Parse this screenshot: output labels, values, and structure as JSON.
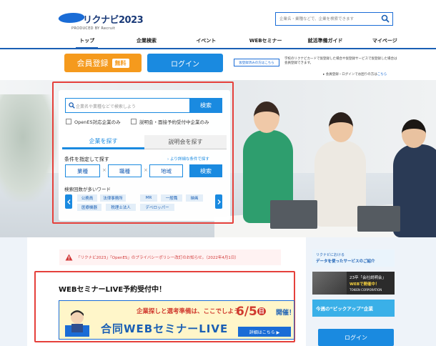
{
  "header": {
    "logo_text": "リクナビ2023",
    "logo_sub": "PRODUCED BY Recruit",
    "search_placeholder": "企業名・業種などで、企業を検索できます",
    "nav": [
      "トップ",
      "企業検索",
      "イベント",
      "WEBセミナー",
      "就活準備ガイド",
      "マイページ"
    ]
  },
  "auth": {
    "register_label": "会員登録",
    "free_badge": "無料",
    "login_label": "ログイン",
    "mynavi_link": "仮登録済みの方はこちら",
    "mynavi_note": "学校のリクナビカードで仮登録した場合や仮登録サービスで仮登録した場合は会員登録できます。",
    "login_note_prefix": "▸ 会員登録・ログインでお困りの方は",
    "login_note_link": "こちら"
  },
  "search_panel": {
    "keyword_placeholder": "企業名や業種などで検索しよう",
    "search_button": "検索",
    "check_openes": "OpenES対応企業のみ",
    "check_briefing": "説明会・面接予約受付中企業のみ",
    "tab_company": "企業を探す",
    "tab_briefing": "説明会を探す",
    "condition_label": "条件を指定して探す",
    "condition_more": "› より詳細な条件で探す",
    "select_industry": "業種",
    "select_job": "職種",
    "select_area": "地域",
    "condition_search": "検索",
    "times": "×",
    "hot_label": "検索回数が多いワード",
    "hot_words": [
      "公務員",
      "法律事務所",
      "MR",
      "一般職",
      "映画",
      "医療機器",
      "税理士法人",
      "デベロッパー"
    ]
  },
  "notice": {
    "text": "「リクナビ2023」「OpenES」のプライバシーポリシー改訂のお知らせ。（2022年4月1日）"
  },
  "web_seminar": {
    "title": "WEBセミナーLIVE予約受付中！",
    "banner_headline": "企業探しと選考準備は、ここでしよう",
    "banner_big": "合同WEBセミナーLIVE",
    "banner_date": "6/5",
    "banner_day": "日",
    "banner_kaisai": "開催！",
    "banner_detail": "詳細はこちら ▶"
  },
  "side_ads": {
    "ad1_line1": "リクナビにおける",
    "ad1_line2": "データを使ったサービスのご紹介",
    "ad2_line1": "23卒「会社説明会」",
    "ad2_line2": "WEBで開催中！",
    "ad2_line3": "TOKIEN CORPORATION",
    "ad3_text": "今週の“ピックアップ”企業",
    "login_label": "ログイン"
  },
  "colors": {
    "brand_blue": "#1a8ae0",
    "orange": "#f59a1d",
    "red_frame": "#e5403b"
  }
}
